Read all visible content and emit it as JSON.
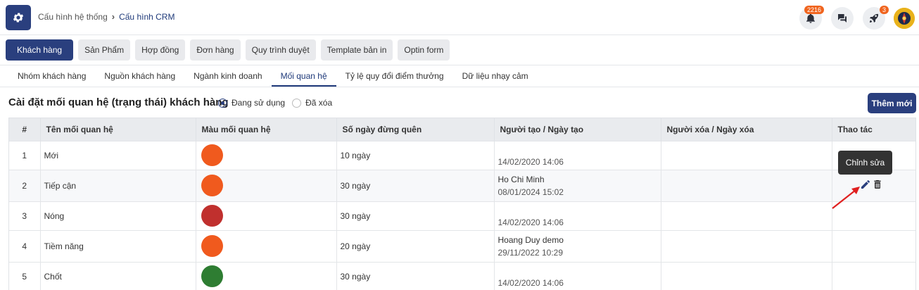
{
  "header": {
    "breadcrumb_parent": "Cấu hình hệ thống",
    "breadcrumb_current": "Cấu hình CRM",
    "notification_count": "2216",
    "rocket_count": "3"
  },
  "module_tabs": [
    "Khách hàng",
    "Sản Phẩm",
    "Hợp đồng",
    "Đơn hàng",
    "Quy trình duyệt",
    "Template bản in",
    "Optin form"
  ],
  "sub_tabs": [
    "Nhóm khách hàng",
    "Nguồn khách hàng",
    "Ngành kinh doanh",
    "Mối quan hệ",
    "Tỷ lệ quy đổi điểm thưởng",
    "Dữ liệu nhạy cảm"
  ],
  "section": {
    "title": "Cài đặt mối quan hệ (trạng thái) khách hàng",
    "radio_active": "Đang sử dụng",
    "radio_deleted": "Đã xóa",
    "add_button": "Thêm mới"
  },
  "table": {
    "headers": [
      "#",
      "Tên mối quan hệ",
      "Màu mối quan hệ",
      "Số ngày đừng quên",
      "Người tạo / Ngày tạo",
      "Người xóa / Ngày xóa",
      "Thao tác"
    ],
    "rows": [
      {
        "num": "1",
        "name": "Mới",
        "color": "#f05a1e",
        "days": "10 ngày",
        "creator": "",
        "created": "14/02/2020 14:06"
      },
      {
        "num": "2",
        "name": "Tiếp cận",
        "color": "#f05a1e",
        "days": "30 ngày",
        "creator": "Ho Chi Minh",
        "created": "08/01/2024 15:02"
      },
      {
        "num": "3",
        "name": "Nóng",
        "color": "#c0302e",
        "days": "30 ngày",
        "creator": "",
        "created": "14/02/2020 14:06"
      },
      {
        "num": "4",
        "name": "Tiềm năng",
        "color": "#f05a1e",
        "days": "20 ngày",
        "creator": "Hoang Duy demo",
        "created": "29/11/2022 10:29"
      },
      {
        "num": "5",
        "name": "Chốt",
        "color": "#2e7d32",
        "days": "30 ngày",
        "creator": "",
        "created": "14/02/2020 14:06"
      }
    ]
  },
  "tooltip": "Chỉnh sửa",
  "icons": {
    "app": "gear-icon",
    "notification": "bell-icon",
    "chat": "chat-icon",
    "rocket": "rocket-icon",
    "edit": "pencil-icon",
    "delete": "trash-icon"
  },
  "colors": {
    "primary": "#2a3f7e",
    "badge": "#f0641e",
    "annotation_arrow": "#e02020"
  }
}
